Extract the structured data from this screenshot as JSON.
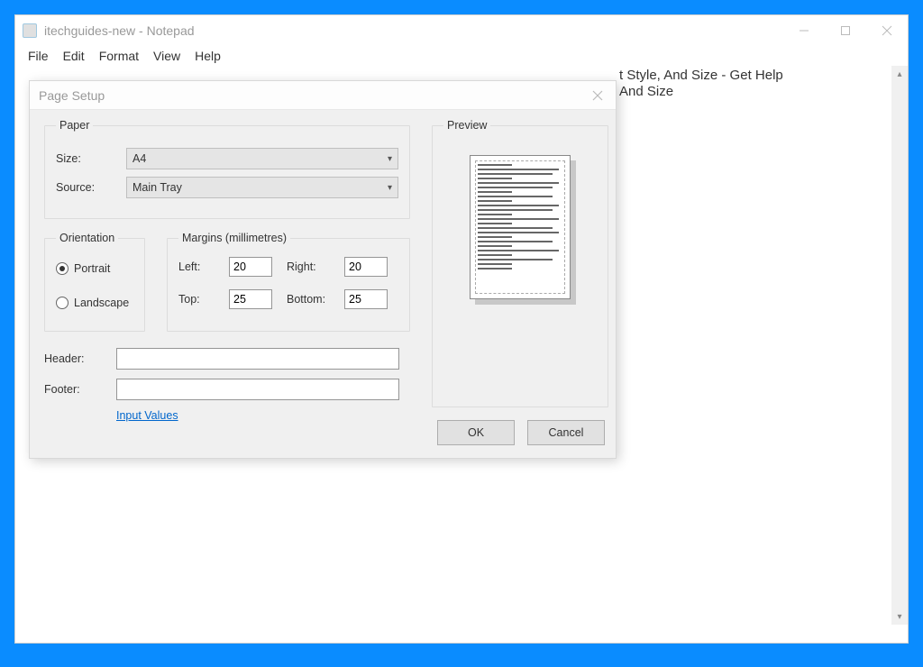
{
  "window": {
    "title": "itechguides-new - Notepad",
    "menubar": [
      "File",
      "Edit",
      "Format",
      "View",
      "Help"
    ]
  },
  "document": {
    "line1_right": "t Style, And Size - Get Help",
    "line2_right": "And Size"
  },
  "dialog": {
    "title": "Page Setup",
    "paper": {
      "legend": "Paper",
      "size_label": "Size:",
      "size_value": "A4",
      "source_label": "Source:",
      "source_value": "Main Tray"
    },
    "orientation": {
      "legend": "Orientation",
      "portrait": "Portrait",
      "landscape": "Landscape",
      "selected": "portrait"
    },
    "margins": {
      "legend": "Margins (millimetres)",
      "left_label": "Left:",
      "left": "20",
      "right_label": "Right:",
      "right": "20",
      "top_label": "Top:",
      "top": "25",
      "bottom_label": "Bottom:",
      "bottom": "25"
    },
    "header_label": "Header:",
    "header_value": "",
    "footer_label": "Footer:",
    "footer_value": "",
    "input_values_link": "Input Values",
    "preview_legend": "Preview",
    "ok": "OK",
    "cancel": "Cancel"
  }
}
